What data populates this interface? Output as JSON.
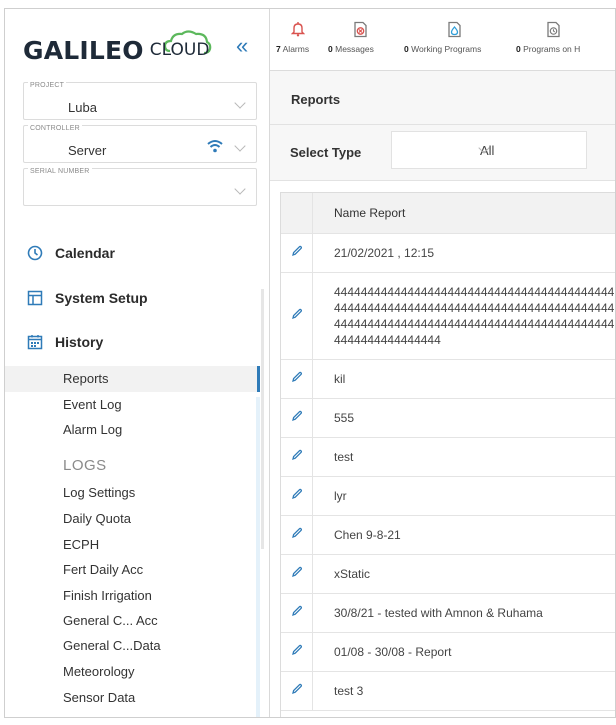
{
  "brand": {
    "word": "GALILEO",
    "cloud": "CLOUD",
    "collapse": "«"
  },
  "sidebar": {
    "project": {
      "label": "PROJECT",
      "value": "Luba"
    },
    "controller": {
      "label": "CONTROLLER",
      "value": "Server"
    },
    "serial": {
      "label": "SERIAL NUMBER",
      "value": ""
    },
    "nav": [
      {
        "label": "Calendar",
        "icon": "clock-icon"
      },
      {
        "label": "System Setup",
        "icon": "layout-icon"
      },
      {
        "label": "History",
        "icon": "calendar-grid-icon"
      }
    ],
    "history_items": [
      "Reports",
      "Event Log",
      "Alarm Log"
    ],
    "logs_heading": "LOGS",
    "log_items": [
      "Log Settings",
      "Daily Quota",
      "ECPH",
      "Fert Daily Acc",
      "Finish Irrigation",
      "General C... Acc",
      "General C...Data",
      "Meteorology",
      "Sensor Data"
    ]
  },
  "topbar": {
    "stats": [
      {
        "count": "7",
        "label": "Alarms",
        "icon": "bell-icon"
      },
      {
        "count": "0",
        "label": "Messages",
        "icon": "message-x-icon"
      },
      {
        "count": "0",
        "label": "Working Programs",
        "icon": "drop-icon"
      },
      {
        "count": "0",
        "label": "Programs on H",
        "icon": "clock-doc-icon"
      }
    ]
  },
  "page": {
    "title": "Reports"
  },
  "filter": {
    "label": "Select Type",
    "value": "All"
  },
  "table": {
    "header": "Name Report",
    "rows": [
      "21/02/2021 , 12:15",
      "4444444444444444444444444444444444444444444444444444444444444444444444444444444444444444444444444444444444444444444444444444444444444444444444",
      "kil",
      "555",
      "test",
      "lyr",
      "Chen 9-8-21",
      "xStatic",
      "30/8/21 - tested with Amnon & Ruhama",
      "01/08 - 30/08 - Report",
      "test 3"
    ]
  },
  "colors": {
    "accent": "#2f7bb8",
    "alarm": "#d9534f",
    "active_bg": "#f2f2f2"
  }
}
